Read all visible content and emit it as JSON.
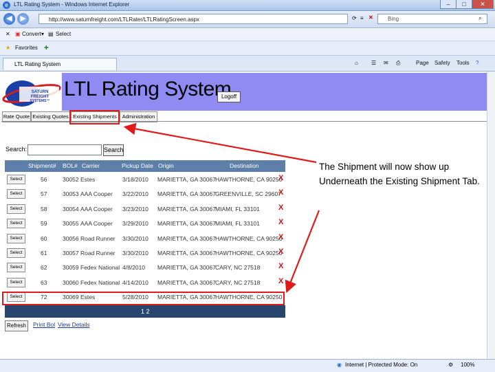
{
  "browser": {
    "window_title": "LTL Rating System - Windows Internet Explorer",
    "url": "http://www.saturnfreight.com/LTLRater/LTLRatingScreen.aspx",
    "search_provider": "Bing",
    "toolbar": {
      "convert": "Convert",
      "select": "Select"
    },
    "favorites": "Favorites",
    "tab_title": "LTL Rating System",
    "commands": {
      "page": "Page",
      "safety": "Safety",
      "tools": "Tools"
    },
    "status": {
      "zone": "Internet | Protected Mode: On",
      "zoom": "100%"
    }
  },
  "app": {
    "logo_text": "SATURN FREIGHT SYSTEMS",
    "title": "LTL Rating System",
    "logoff": "Logoff",
    "tabs": [
      "Rate Quote",
      "Existing Quotes",
      "Existing Shipments",
      "Administration"
    ],
    "search_label": "Search:",
    "search_button": "Search",
    "select_label": "Select",
    "columns": [
      "Shipment#",
      "BOL#",
      "Carrier",
      "Pickup Date",
      "Origin",
      "Destination"
    ],
    "rows": [
      {
        "shipment": "56",
        "bol": "30052",
        "carrier": "Estes",
        "pickup": "3/18/2010",
        "origin": "MARIETTA, GA 30067",
        "destination": "HAWTHORNE, CA 90250",
        "delete": "X"
      },
      {
        "shipment": "57",
        "bol": "30053",
        "carrier": "AAA Cooper",
        "pickup": "3/22/2010",
        "origin": "MARIETTA, GA 30067",
        "destination": "GREENVILLE, SC 29607",
        "delete": "X"
      },
      {
        "shipment": "58",
        "bol": "30054",
        "carrier": "AAA Cooper",
        "pickup": "3/23/2010",
        "origin": "MARIETTA, GA 30067",
        "destination": "MIAMI, FL 33101",
        "delete": "X"
      },
      {
        "shipment": "59",
        "bol": "30055",
        "carrier": "AAA Cooper",
        "pickup": "3/29/2010",
        "origin": "MARIETTA, GA 30067",
        "destination": "MIAMI, FL 33101",
        "delete": "X"
      },
      {
        "shipment": "60",
        "bol": "30056",
        "carrier": "Road Runner",
        "pickup": "3/30/2010",
        "origin": "MARIETTA, GA 30067",
        "destination": "HAWTHORNE, CA 90250",
        "delete": "X"
      },
      {
        "shipment": "61",
        "bol": "30057",
        "carrier": "Road Runner",
        "pickup": "3/30/2010",
        "origin": "MARIETTA, GA 30067",
        "destination": "HAWTHORNE, CA 90250",
        "delete": "X"
      },
      {
        "shipment": "62",
        "bol": "30059",
        "carrier": "Fedex National",
        "pickup": "4/8/2010",
        "origin": "MARIETTA, GA 30067",
        "destination": "CARY, NC 27518",
        "delete": "X"
      },
      {
        "shipment": "63",
        "bol": "30060",
        "carrier": "Fedex National",
        "pickup": "4/14/2010",
        "origin": "MARIETTA, GA 30067",
        "destination": "CARY, NC 27518",
        "delete": "X"
      },
      {
        "shipment": "72",
        "bol": "30069",
        "carrier": "Estes",
        "pickup": "5/28/2010",
        "origin": "MARIETTA, GA 30067",
        "destination": "HAWTHORNE, CA 90250",
        "delete": ""
      }
    ],
    "pager": "1 2",
    "refresh": "Refresh",
    "print_bol": "Print Bol",
    "view_details": "View Details"
  },
  "annotation": {
    "text": "The Shipment will now show up Underneath the Existing Shipment Tab.",
    "highlight_color": "#e01a1a"
  },
  "colors": {
    "header_band": "#8f8bf2",
    "grid_header": "#5e7fa8",
    "pager": "#28456e"
  }
}
